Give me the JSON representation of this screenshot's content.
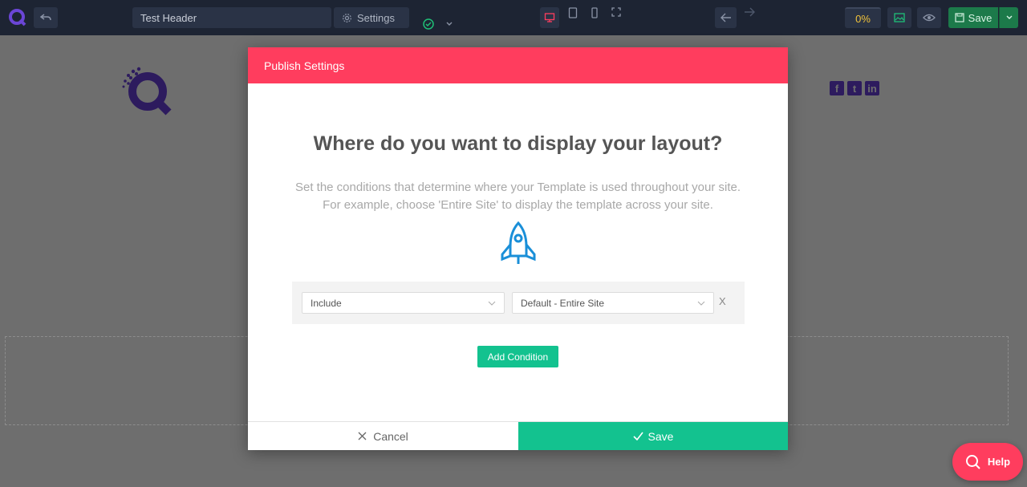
{
  "toolbar": {
    "template_title": "Test Header",
    "settings_label": "Settings",
    "progress": "0%",
    "save_label": "Save"
  },
  "modal": {
    "header": "Publish Settings",
    "title": "Where do you want to display your layout?",
    "description_line1": "Set the conditions that determine where your Template is used throughout your site.",
    "description_line2": "For example, choose 'Entire Site' to display the template across your site.",
    "condition": {
      "include_value": "Include",
      "target_value": "Default - Entire Site",
      "remove_label": "X"
    },
    "add_condition_label": "Add Condition",
    "cancel_label": "Cancel",
    "save_label": "Save"
  },
  "help_label": "Help",
  "colors": {
    "toolbar_bg": "#1d2433",
    "modal_header": "#ff3d5e",
    "accent_green": "#13c28f",
    "brand_purple": "#5a2fb0"
  }
}
